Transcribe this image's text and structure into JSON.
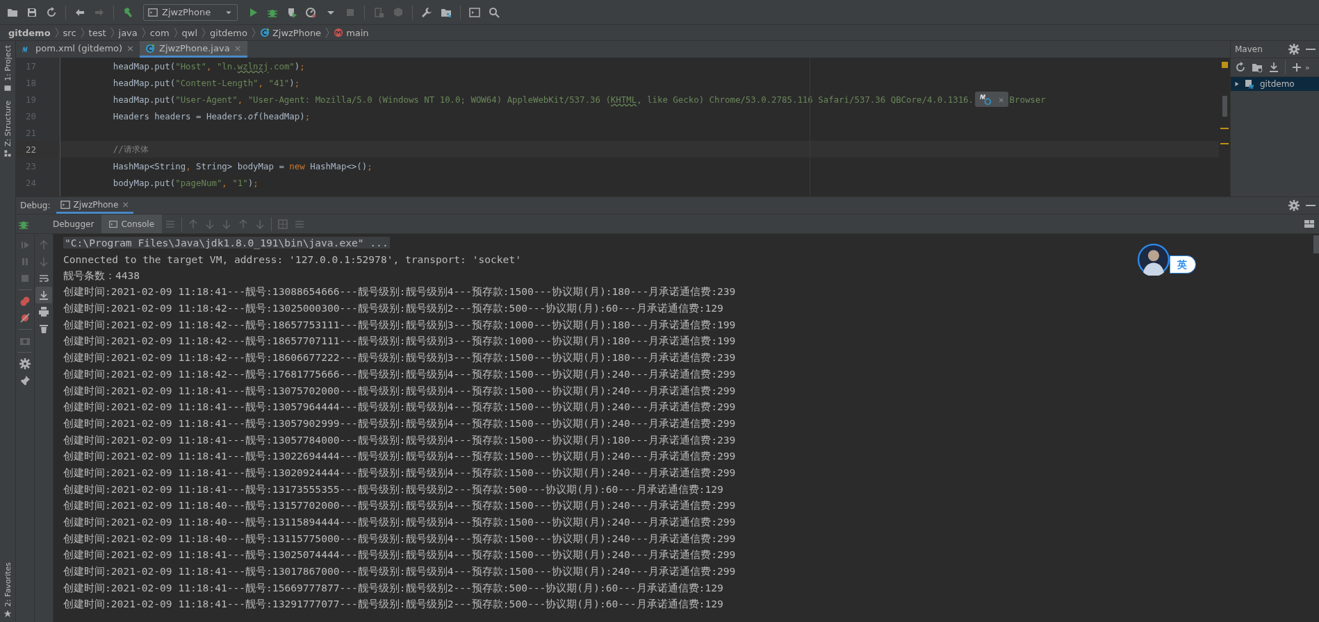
{
  "toolbar": {
    "run_config": "ZjwzPhone"
  },
  "breadcrumbs": [
    {
      "label": "gitdemo",
      "kind": "project"
    },
    {
      "label": "src",
      "kind": "folder"
    },
    {
      "label": "test",
      "kind": "folder"
    },
    {
      "label": "java",
      "kind": "folder"
    },
    {
      "label": "com",
      "kind": "folder"
    },
    {
      "label": "qwl",
      "kind": "folder"
    },
    {
      "label": "gitdemo",
      "kind": "folder"
    },
    {
      "label": "ZjwzPhone",
      "kind": "class"
    },
    {
      "label": "main",
      "kind": "method"
    }
  ],
  "left_stripe": {
    "top": [
      "1: Project",
      "Z: Structure"
    ],
    "bottom": [
      "2: Favorites"
    ]
  },
  "editor_tabs": [
    {
      "label": "pom.xml (gitdemo)",
      "kind": "maven",
      "selected": false,
      "close": "×"
    },
    {
      "label": "ZjwzPhone.java",
      "kind": "class",
      "selected": true,
      "close": "×"
    }
  ],
  "editor": {
    "lines": [
      {
        "number": "17",
        "current": false,
        "tokens": [
          {
            "kind": "plain",
            "text": "        headMap.put("
          },
          {
            "kind": "string",
            "text": "\"Host\""
          },
          {
            "kind": "keyword",
            "text": ", "
          },
          {
            "kind": "string",
            "text": "\"ln."
          },
          {
            "kind": "typo",
            "text": "wzlnzj"
          },
          {
            "kind": "string",
            "text": ".com\""
          },
          {
            "kind": "plain",
            "text": ")"
          },
          {
            "kind": "keyword",
            "text": ";"
          }
        ]
      },
      {
        "number": "18",
        "current": false,
        "tokens": [
          {
            "kind": "plain",
            "text": "        headMap.put("
          },
          {
            "kind": "string",
            "text": "\"Content-Length\""
          },
          {
            "kind": "keyword",
            "text": ", "
          },
          {
            "kind": "string",
            "text": "\"41\""
          },
          {
            "kind": "plain",
            "text": ")"
          },
          {
            "kind": "keyword",
            "text": ";"
          }
        ]
      },
      {
        "number": "19",
        "current": false,
        "tokens": [
          {
            "kind": "plain",
            "text": "        headMap.put("
          },
          {
            "kind": "string",
            "text": "\"User-Agent\""
          },
          {
            "kind": "keyword",
            "text": ", "
          },
          {
            "kind": "string",
            "text": "\"User-Agent: Mozilla/5.0 (Windows NT 10.0; WOW64) AppleWebKit/537.36 ("
          },
          {
            "kind": "typo",
            "text": "KHTML"
          },
          {
            "kind": "string",
            "text": ", like Gecko) Chrome/53.0.2785.116 Safari/537.36 QBCore/4.0.1316."
          }
        ]
      },
      {
        "number": "20",
        "current": false,
        "tokens": [
          {
            "kind": "plain",
            "text": "        Headers headers = Headers."
          },
          {
            "kind": "italic",
            "text": "of"
          },
          {
            "kind": "plain",
            "text": "(headMap)"
          },
          {
            "kind": "keyword",
            "text": ";"
          }
        ]
      },
      {
        "number": "21",
        "current": false
      },
      {
        "number": "22",
        "current": true,
        "tokens": [
          {
            "kind": "comment",
            "text": "        //请求体"
          }
        ]
      },
      {
        "number": "23",
        "current": false,
        "tokens": [
          {
            "kind": "plain",
            "text": "        HashMap<String"
          },
          {
            "kind": "keyword",
            "text": ", "
          },
          {
            "kind": "plain",
            "text": "String> bodyMap = "
          },
          {
            "kind": "keyword",
            "text": "new "
          },
          {
            "kind": "plain",
            "text": "HashMap<>()"
          },
          {
            "kind": "keyword",
            "text": ";"
          }
        ]
      },
      {
        "number": "24",
        "current": false,
        "tokens": [
          {
            "kind": "plain",
            "text": "        bodyMap.put("
          },
          {
            "kind": "string",
            "text": "\"pageNum\""
          },
          {
            "kind": "keyword",
            "text": ", "
          },
          {
            "kind": "string",
            "text": "\"1\""
          },
          {
            "kind": "plain",
            "text": ")"
          },
          {
            "kind": "keyword",
            "text": ";"
          }
        ]
      }
    ],
    "popup": {
      "close": "×"
    },
    "overflow_text": "Browser"
  },
  "maven": {
    "title": "Maven",
    "more": "»",
    "tree": [
      {
        "label": "gitdemo",
        "expanded": false,
        "selected": true
      }
    ]
  },
  "debug": {
    "title": "Debug:",
    "session": {
      "label": "ZjwzPhone",
      "close": "×"
    },
    "tabs": [
      {
        "label": "Debugger",
        "selected": false
      },
      {
        "label": "Console",
        "selected": true
      }
    ],
    "console": [
      {
        "kind": "command",
        "text": "\"C:\\Program Files\\Java\\jdk1.8.0_191\\bin\\java.exe\" ..."
      },
      {
        "kind": "output",
        "text": "Connected to the target VM, address: '127.0.0.1:52978', transport: 'socket'"
      },
      {
        "kind": "output",
        "text": "靓号条数：4438"
      },
      {
        "kind": "output",
        "text": "创建时间:2021-02-09 11:18:41---靓号:13088654666---靓号级别:靓号级别4---预存款:1500---协议期(月):180---月承诺通信费:239"
      },
      {
        "kind": "output",
        "text": "创建时间:2021-02-09 11:18:42---靓号:13025000300---靓号级别:靓号级别2---预存款:500---协议期(月):60---月承诺通信费:129"
      },
      {
        "kind": "output",
        "text": "创建时间:2021-02-09 11:18:42---靓号:18657753111---靓号级别:靓号级别3---预存款:1000---协议期(月):180---月承诺通信费:199"
      },
      {
        "kind": "output",
        "text": "创建时间:2021-02-09 11:18:42---靓号:18657707111---靓号级别:靓号级别3---预存款:1000---协议期(月):180---月承诺通信费:199"
      },
      {
        "kind": "output",
        "text": "创建时间:2021-02-09 11:18:42---靓号:18606677222---靓号级别:靓号级别3---预存款:1500---协议期(月):180---月承诺通信费:239"
      },
      {
        "kind": "output",
        "text": "创建时间:2021-02-09 11:18:42---靓号:17681775666---靓号级别:靓号级别4---预存款:1500---协议期(月):240---月承诺通信费:299"
      },
      {
        "kind": "output",
        "text": "创建时间:2021-02-09 11:18:41---靓号:13075702000---靓号级别:靓号级别4---预存款:1500---协议期(月):240---月承诺通信费:299"
      },
      {
        "kind": "output",
        "text": "创建时间:2021-02-09 11:18:41---靓号:13057964444---靓号级别:靓号级别4---预存款:1500---协议期(月):240---月承诺通信费:299"
      },
      {
        "kind": "output",
        "text": "创建时间:2021-02-09 11:18:41---靓号:13057902999---靓号级别:靓号级别4---预存款:1500---协议期(月):240---月承诺通信费:299"
      },
      {
        "kind": "output",
        "text": "创建时间:2021-02-09 11:18:41---靓号:13057784000---靓号级别:靓号级别4---预存款:1500---协议期(月):180---月承诺通信费:239"
      },
      {
        "kind": "output",
        "text": "创建时间:2021-02-09 11:18:41---靓号:13022694444---靓号级别:靓号级别4---预存款:1500---协议期(月):240---月承诺通信费:299"
      },
      {
        "kind": "output",
        "text": "创建时间:2021-02-09 11:18:41---靓号:13020924444---靓号级别:靓号级别4---预存款:1500---协议期(月):240---月承诺通信费:299"
      },
      {
        "kind": "output",
        "text": "创建时间:2021-02-09 11:18:41---靓号:13173555355---靓号级别:靓号级别2---预存款:500---协议期(月):60---月承诺通信费:129"
      },
      {
        "kind": "output",
        "text": "创建时间:2021-02-09 11:18:40---靓号:13157702000---靓号级别:靓号级别4---预存款:1500---协议期(月):240---月承诺通信费:299"
      },
      {
        "kind": "output",
        "text": "创建时间:2021-02-09 11:18:40---靓号:13115894444---靓号级别:靓号级别4---预存款:1500---协议期(月):240---月承诺通信费:299"
      },
      {
        "kind": "output",
        "text": "创建时间:2021-02-09 11:18:40---靓号:13115775000---靓号级别:靓号级别4---预存款:1500---协议期(月):240---月承诺通信费:299"
      },
      {
        "kind": "output",
        "text": "创建时间:2021-02-09 11:18:41---靓号:13025074444---靓号级别:靓号级别4---预存款:1500---协议期(月):240---月承诺通信费:299"
      },
      {
        "kind": "output",
        "text": "创建时间:2021-02-09 11:18:41---靓号:13017867000---靓号级别:靓号级别4---预存款:1500---协议期(月):240---月承诺通信费:299"
      },
      {
        "kind": "output",
        "text": "创建时间:2021-02-09 11:18:41---靓号:15669777877---靓号级别:靓号级别2---预存款:500---协议期(月):60---月承诺通信费:129"
      },
      {
        "kind": "output",
        "text": "创建时间:2021-02-09 11:18:41---靓号:13291777077---靓号级别:靓号级别2---预存款:500---协议期(月):60---月承诺通信费:129"
      }
    ]
  },
  "ime": {
    "label": "英"
  }
}
